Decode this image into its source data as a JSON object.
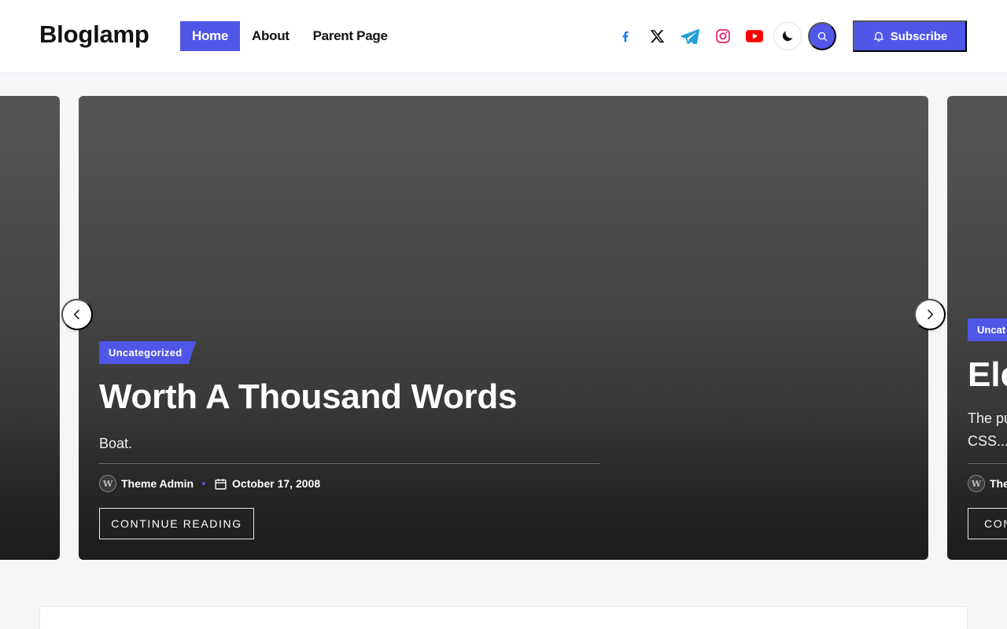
{
  "header": {
    "logo": "Bloglamp",
    "nav": [
      {
        "label": "Home",
        "active": true
      },
      {
        "label": "About",
        "active": false
      },
      {
        "label": "Parent Page",
        "active": false
      }
    ],
    "social_icons": [
      "facebook-icon",
      "x-twitter-icon",
      "telegram-icon",
      "instagram-icon",
      "youtube-icon"
    ],
    "subscribe_label": "Subscribe",
    "accent_color": "#5056e8"
  },
  "slider": {
    "main": {
      "category": "Uncategorized",
      "title": "Worth A Thousand Words",
      "excerpt": "Boat.",
      "author": "Theme Admin",
      "date": "October 17, 2008",
      "read_more": "CONTINUE READING"
    },
    "next_partial": {
      "category": "Uncat",
      "title": "Ele",
      "excerpt_line1": "The pu",
      "excerpt_line2": "CSS...",
      "author": "The",
      "read_more": "CON"
    }
  }
}
